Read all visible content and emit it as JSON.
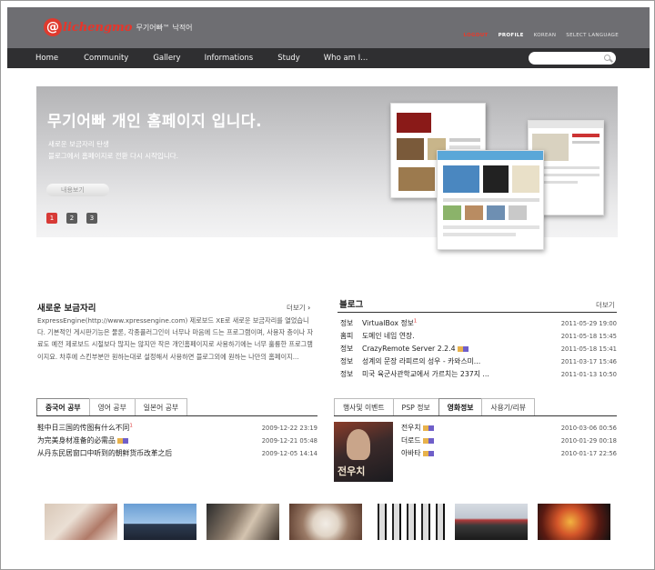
{
  "header": {
    "logo_mark": "@",
    "logo_name": "lichengmo",
    "logo_tagline": "무기어빠™ 낙적어",
    "util_links": [
      "LOGOUT",
      "PROFILE",
      "KOREAN",
      "SELECT LANGUAGE"
    ]
  },
  "nav": {
    "items": [
      "Home",
      "Community",
      "Gallery",
      "Informations",
      "Study",
      "Who am I..."
    ],
    "search_placeholder": ""
  },
  "hero": {
    "title": "무기어빠 개인 홈페이지 입니다.",
    "desc_line1": "새로운 보금자리 탄생",
    "desc_line2": "블로그에서 홈페이지로 전환 다시 시작입니다.",
    "more_label": "내용보기",
    "pages": [
      "1",
      "2",
      "3"
    ],
    "active_page": 1
  },
  "intro": {
    "title": "새로운 보금자리",
    "more": "더보기",
    "body": "ExpressEngine(http://www.xpressengine.com) 제로보드 XE로 새로운 보금자리를 열었습니다. 기본적인 게시판기능은 물론, 각종플러그인이 너무나 마음에 드는 프로그램이며, 사용자 층이나 자료도 예전 제로보드 시절보다 많지는 않지만 작은 개인홈페이지로 사용하기에는 너무 훌륭한 프로그램이지요. 차후에 스킨부분만 원하는대로 설정해서 사용하면 블로그외에 원하는 나만의 홈페이지..."
  },
  "blog": {
    "title": "블로그",
    "more": "더보기",
    "rows": [
      {
        "cat": "정보",
        "title": "VirtualBox 정보",
        "sup": "1",
        "icons": false,
        "date": "2011-05-29",
        "time": "19:00"
      },
      {
        "cat": "홈피",
        "title": "도메인 네임 연장.",
        "sup": "",
        "icons": false,
        "date": "2011-05-18",
        "time": "15:45"
      },
      {
        "cat": "정보",
        "title": "CrazyRemote Server 2.2.4",
        "sup": "",
        "icons": true,
        "date": "2011-05-18",
        "time": "15:41"
      },
      {
        "cat": "정보",
        "title": "성계의 문장 라피르의 성우 - 카와스미...",
        "sup": "",
        "icons": false,
        "date": "2011-03-17",
        "time": "15:46"
      },
      {
        "cat": "정보",
        "title": "미국 육군사관학교에서 가르치는 237지 ...",
        "sup": "",
        "icons": false,
        "date": "2011-01-13",
        "time": "10:50"
      }
    ]
  },
  "study": {
    "tabs": [
      "중국어 공부",
      "영어 공부",
      "일본어 공부"
    ],
    "active_tab": 0,
    "rows": [
      {
        "title": "鞋中日三国的传图有什么不同",
        "sup": "1",
        "icons": false,
        "date": "2009-12-22",
        "time": "23:19"
      },
      {
        "title": "为完美身材准备的必需品",
        "sup": "",
        "icons": true,
        "date": "2009-12-21",
        "time": "05:48"
      },
      {
        "title": "从丹东民居窗口中听到的朝鲜货币改革之后",
        "sup": "",
        "icons": false,
        "date": "2009-12-05",
        "time": "14:14"
      }
    ]
  },
  "events": {
    "tabs": [
      "행사및 이벤트",
      "PSP 정보",
      "영화정보",
      "사용기/리뷰"
    ],
    "active_tab": 2,
    "rows": [
      {
        "title": "전우치",
        "icons": true,
        "date": "2010-03-06",
        "time": "00:56"
      },
      {
        "title": "더로드",
        "icons": true,
        "date": "2010-01-29",
        "time": "00:18"
      },
      {
        "title": "아바타",
        "icons": true,
        "date": "2010-01-17",
        "time": "22:56"
      }
    ],
    "poster_text": "전우치"
  },
  "colors": {
    "accent": "#e03a2e",
    "header_bg": "#6e6e72",
    "nav_bg": "#2f2f31"
  }
}
